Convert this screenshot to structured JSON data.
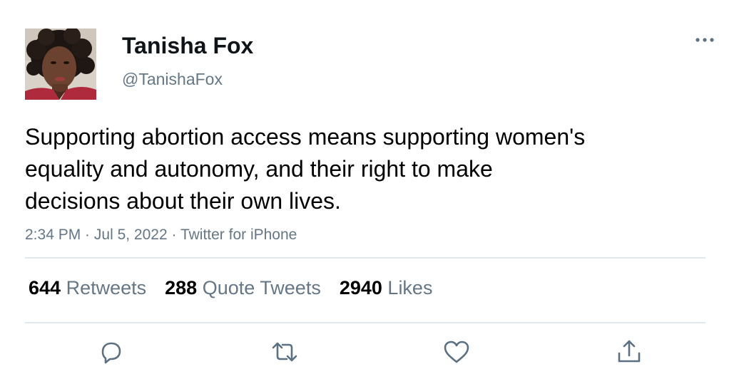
{
  "user": {
    "display_name": "Tanisha Fox",
    "handle": "@TanishaFox",
    "avatar_icon": "profile-photo"
  },
  "tweet": {
    "text": "Supporting abortion access means supporting women's\nequality and autonomy, and their right to make\ndecisions about their own lives.",
    "time": "2:34 PM",
    "date": "Jul 5, 2022",
    "source": "Twitter for iPhone",
    "separator": " · "
  },
  "stats": {
    "retweets": {
      "count": "644",
      "label": "Retweets"
    },
    "quote_tweets": {
      "count": "288",
      "label": "Quote Tweets"
    },
    "likes": {
      "count": "2940",
      "label": "Likes"
    }
  },
  "actions": [
    "reply-icon",
    "retweet-icon",
    "like-icon",
    "share-icon"
  ],
  "colors": {
    "text": "#0f1419",
    "secondary": "#657786",
    "divider": "#e1e8ed",
    "icon": "#5b7083"
  }
}
